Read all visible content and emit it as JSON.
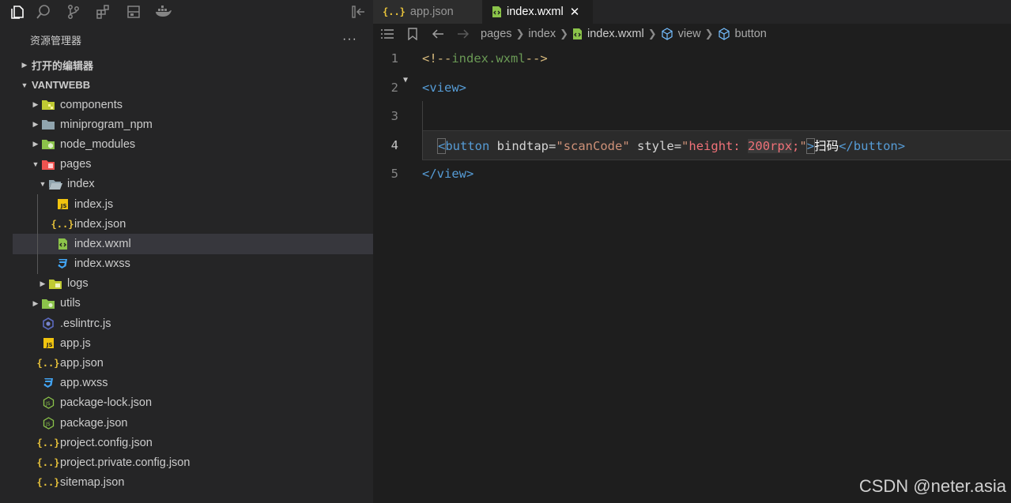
{
  "activity": {
    "icons": [
      "explorer-icon",
      "search-icon",
      "source-control-icon",
      "extensions-icon",
      "remote-icon",
      "docker-icon",
      "collapse-panel-icon"
    ]
  },
  "sidebar": {
    "title": "资源管理器",
    "more": "···",
    "sections": [
      {
        "label": "打开的编辑器",
        "expanded": false
      },
      {
        "label": "VANTWEBB",
        "expanded": true
      }
    ],
    "tree": [
      {
        "label": "components",
        "icon": "folder-components-icon",
        "type": "folder",
        "expanded": false
      },
      {
        "label": "miniprogram_npm",
        "icon": "folder-icon",
        "type": "folder",
        "expanded": false
      },
      {
        "label": "node_modules",
        "icon": "folder-node-icon",
        "type": "folder",
        "expanded": false
      },
      {
        "label": "pages",
        "icon": "folder-pages-icon",
        "type": "folder",
        "expanded": true
      },
      {
        "label": "index",
        "icon": "folder-open-icon",
        "type": "folder",
        "expanded": true
      },
      {
        "label": "index.js",
        "icon": "js-icon",
        "type": "file"
      },
      {
        "label": "index.json",
        "icon": "json-icon",
        "type": "file"
      },
      {
        "label": "index.wxml",
        "icon": "wxml-icon",
        "type": "file",
        "selected": true
      },
      {
        "label": "index.wxss",
        "icon": "css-icon",
        "type": "file"
      },
      {
        "label": "logs",
        "icon": "folder-logs-icon",
        "type": "folder",
        "expanded": false
      },
      {
        "label": "utils",
        "icon": "folder-utils-icon",
        "type": "folder",
        "expanded": false
      },
      {
        "label": ".eslintrc.js",
        "icon": "eslint-icon",
        "type": "file"
      },
      {
        "label": "app.js",
        "icon": "js-icon",
        "type": "file"
      },
      {
        "label": "app.json",
        "icon": "json-icon",
        "type": "file"
      },
      {
        "label": "app.wxss",
        "icon": "css-icon",
        "type": "file"
      },
      {
        "label": "package-lock.json",
        "icon": "nodejs-icon",
        "type": "file"
      },
      {
        "label": "package.json",
        "icon": "nodejs-icon",
        "type": "file"
      },
      {
        "label": "project.config.json",
        "icon": "json-icon",
        "type": "file"
      },
      {
        "label": "project.private.config.json",
        "icon": "json-icon",
        "type": "file"
      },
      {
        "label": "sitemap.json",
        "icon": "json-icon",
        "type": "file"
      }
    ]
  },
  "tabs": [
    {
      "label": "app.json",
      "icon": "json-icon",
      "active": false
    },
    {
      "label": "index.wxml",
      "icon": "wxml-icon",
      "active": true,
      "close": "✕"
    }
  ],
  "breadcrumb": {
    "items": [
      "pages",
      "index",
      "index.wxml",
      "view",
      "button"
    ]
  },
  "editor": {
    "current_line": 4,
    "lines": [
      {
        "num": "1",
        "text": "<!--index.wxml-->"
      },
      {
        "num": "2",
        "text": "<view>"
      },
      {
        "num": "3",
        "text": ""
      },
      {
        "num": "4",
        "text": "<button bindtap=\"scanCode\" style=\"height: 200rpx;\">扫码</button>"
      },
      {
        "num": "5",
        "text": "</view>"
      }
    ],
    "tokens": {
      "l1_open": "<!--",
      "l1_body": "index.wxml",
      "l1_close": "-->",
      "l2_lt": "<",
      "l2_tag": "view",
      "l2_gt": ">",
      "l4_lt": "<",
      "l4_tag": "button",
      "l4_attr1": " bindtap",
      "l4_eq1": "=",
      "l4_q1": "\"",
      "l4_val1": "scanCode",
      "l4_q1b": "\"",
      "l4_attr2": " style",
      "l4_eq2": "=",
      "l4_q2": "\"",
      "l4_css_prop": "height: ",
      "l4_css_num": "200rpx",
      "l4_css_semi": ";",
      "l4_q2b": "\"",
      "l4_gt": ">",
      "l4_text": "扫码",
      "l4_close_lt": "</",
      "l4_close_tag": "button",
      "l4_close_gt": ">",
      "l5_lt": "</",
      "l5_tag": "view",
      "l5_gt": ">"
    }
  },
  "watermark": "CSDN @neter.asia",
  "colors": {
    "tag": "#569cd6",
    "string": "#ce9178",
    "comment": "#d7ba7d",
    "selection": "#37373d"
  }
}
